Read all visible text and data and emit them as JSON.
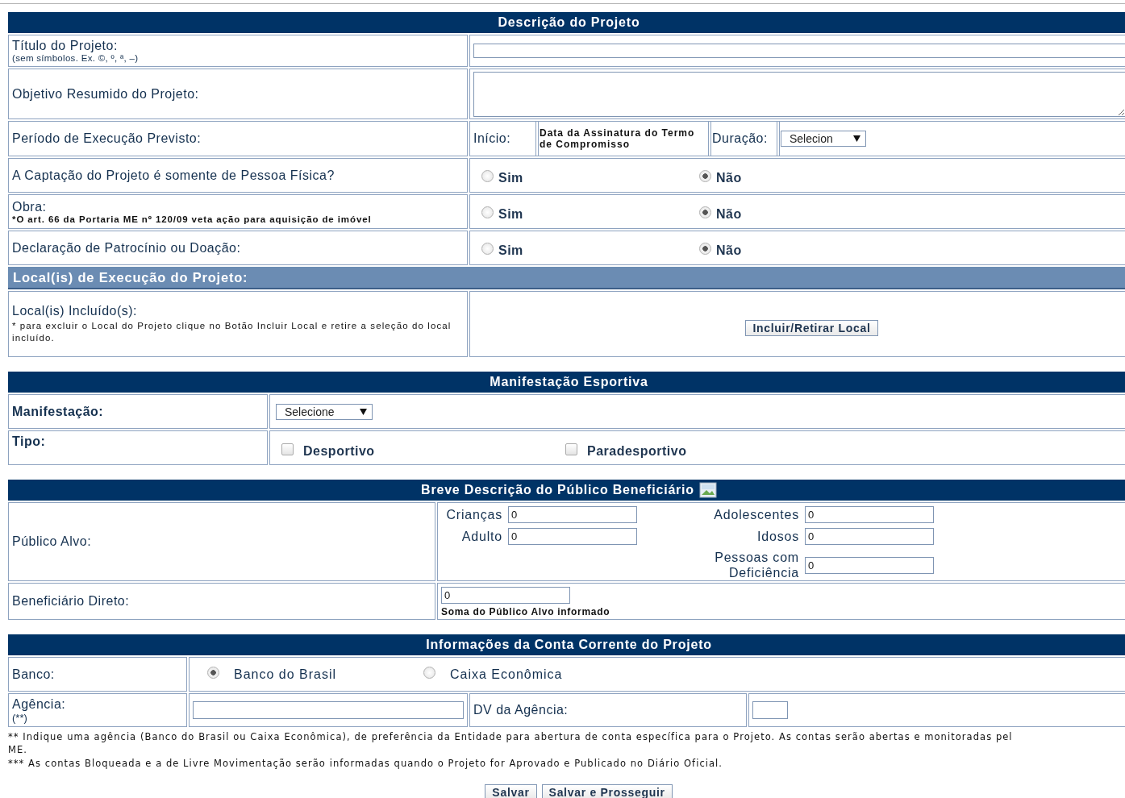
{
  "descricao": {
    "title": "Descrição do Projeto",
    "titulo": {
      "label": "Título do Projeto:",
      "hint": "(sem símbolos. Ex. ©, º, ª, –)"
    },
    "objetivo": {
      "label": "Objetivo Resumido do Projeto:"
    },
    "periodo": {
      "label": "Período de Execução Previsto:",
      "inicio_label": "Início:",
      "inicio_value": "Data da Assinatura do Termo de Compromisso",
      "duracao_label": "Duração:",
      "duracao_select": "Selecion"
    },
    "questions": [
      {
        "label": "A Captação do Projeto é somente de Pessoa Física?",
        "options": [
          {
            "label": "Sim",
            "selected": false
          },
          {
            "label": "Não",
            "selected": true
          }
        ]
      },
      {
        "label": "Obra:",
        "note": "*O art. 66 da Portaria ME nº 120/09 veta ação para aquisição de imóvel",
        "options": [
          {
            "label": "Sim",
            "selected": false
          },
          {
            "label": "Não",
            "selected": true
          }
        ]
      },
      {
        "label": "Declaração de Patrocínio ou Doação:",
        "options": [
          {
            "label": "Sim",
            "selected": false
          },
          {
            "label": "Não",
            "selected": true
          }
        ]
      }
    ]
  },
  "locais": {
    "title": "Local(is) de Execução do Projeto:",
    "label": "Local(is) Incluído(s):",
    "note": "* para excluir o Local do Projeto clique no Botão Incluir Local e retire a seleção do local incluído.",
    "button": "Incluir/Retirar Local"
  },
  "manifestacao": {
    "title": "Manifestação Esportiva",
    "label": "Manifestação:",
    "select": "Selecione",
    "tipo_label": "Tipo:",
    "tipos": [
      {
        "label": "Desportivo",
        "checked": false
      },
      {
        "label": "Paradesportivo",
        "checked": false
      }
    ]
  },
  "publico": {
    "title": "Breve Descrição do Público Beneficiário",
    "alvo_label": "Público Alvo:",
    "left": [
      {
        "label": "Crianças",
        "value": "0"
      },
      {
        "label": "Adulto",
        "value": "0"
      }
    ],
    "right": [
      {
        "label": "Adolescentes",
        "value": "0"
      },
      {
        "label": "Idosos",
        "value": "0"
      },
      {
        "label": "Pessoas com Deficiência",
        "value": "0"
      }
    ],
    "direto_label": "Beneficiário Direto:",
    "direto_value": "0",
    "direto_note": "Soma do Público Alvo informado"
  },
  "conta": {
    "title": "Informações da Conta Corrente do Projeto",
    "banco_label": "Banco:",
    "bancos": [
      {
        "label": "Banco do Brasil",
        "selected": true
      },
      {
        "label": "Caixa Econômica",
        "selected": false
      }
    ],
    "agencia_label": "Agência:",
    "agencia_note": "(**)",
    "dv_label": "DV da Agência:"
  },
  "footnotes": [
    "** Indique uma agência (Banco do Brasil ou Caixa Econômica), de preferência da Entidade para abertura de conta específica para o Projeto. As contas serão abertas e monitoradas pel",
    "ME.",
    "*** As contas Bloqueada e a de Livre Movimentação serão informadas quando o Projeto for Aprovado e Publicado no Diário Oficial."
  ],
  "buttons": [
    "Salvar",
    "Salvar e Prosseguir"
  ]
}
